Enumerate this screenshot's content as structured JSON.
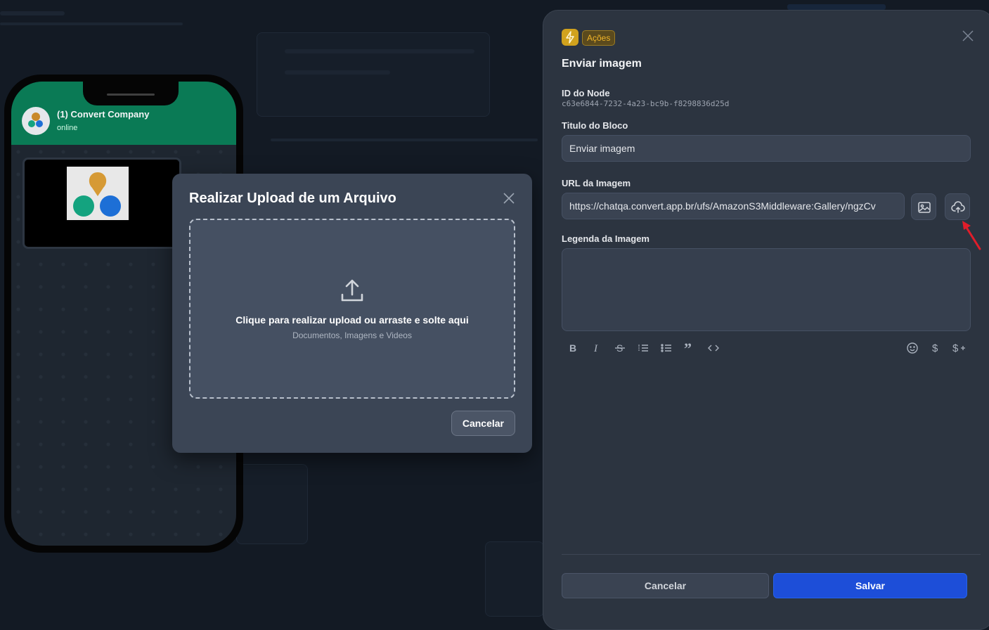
{
  "phone": {
    "contact_name": "(1) Convert Company",
    "contact_status": "online"
  },
  "upload_modal": {
    "title": "Realizar Upload de um Arquivo",
    "drop_text": "Clique para realizar upload ou arraste e solte aqui",
    "drop_subtext": "Documentos, Imagens e Videos",
    "cancel_label": "Cancelar"
  },
  "panel": {
    "badge": "Ações",
    "title": "Enviar imagem",
    "node_id_label": "ID do Node",
    "node_id_value": "c63e6844-7232-4a23-bc9b-f8298836d25d",
    "block_title_label": "Titulo do Bloco",
    "block_title_value": "Enviar imagem",
    "image_url_label": "URL da Imagem",
    "image_url_value": "https://chatqa.convert.app.br/ufs/AmazonS3Middleware:Gallery/ngzCv",
    "caption_label": "Legenda da Imagem",
    "cancel_label": "Cancelar",
    "save_label": "Salvar"
  },
  "colors": {
    "accent": "#1d4ed8",
    "badge": "#f0b429",
    "header_green": "#0a7a55"
  }
}
